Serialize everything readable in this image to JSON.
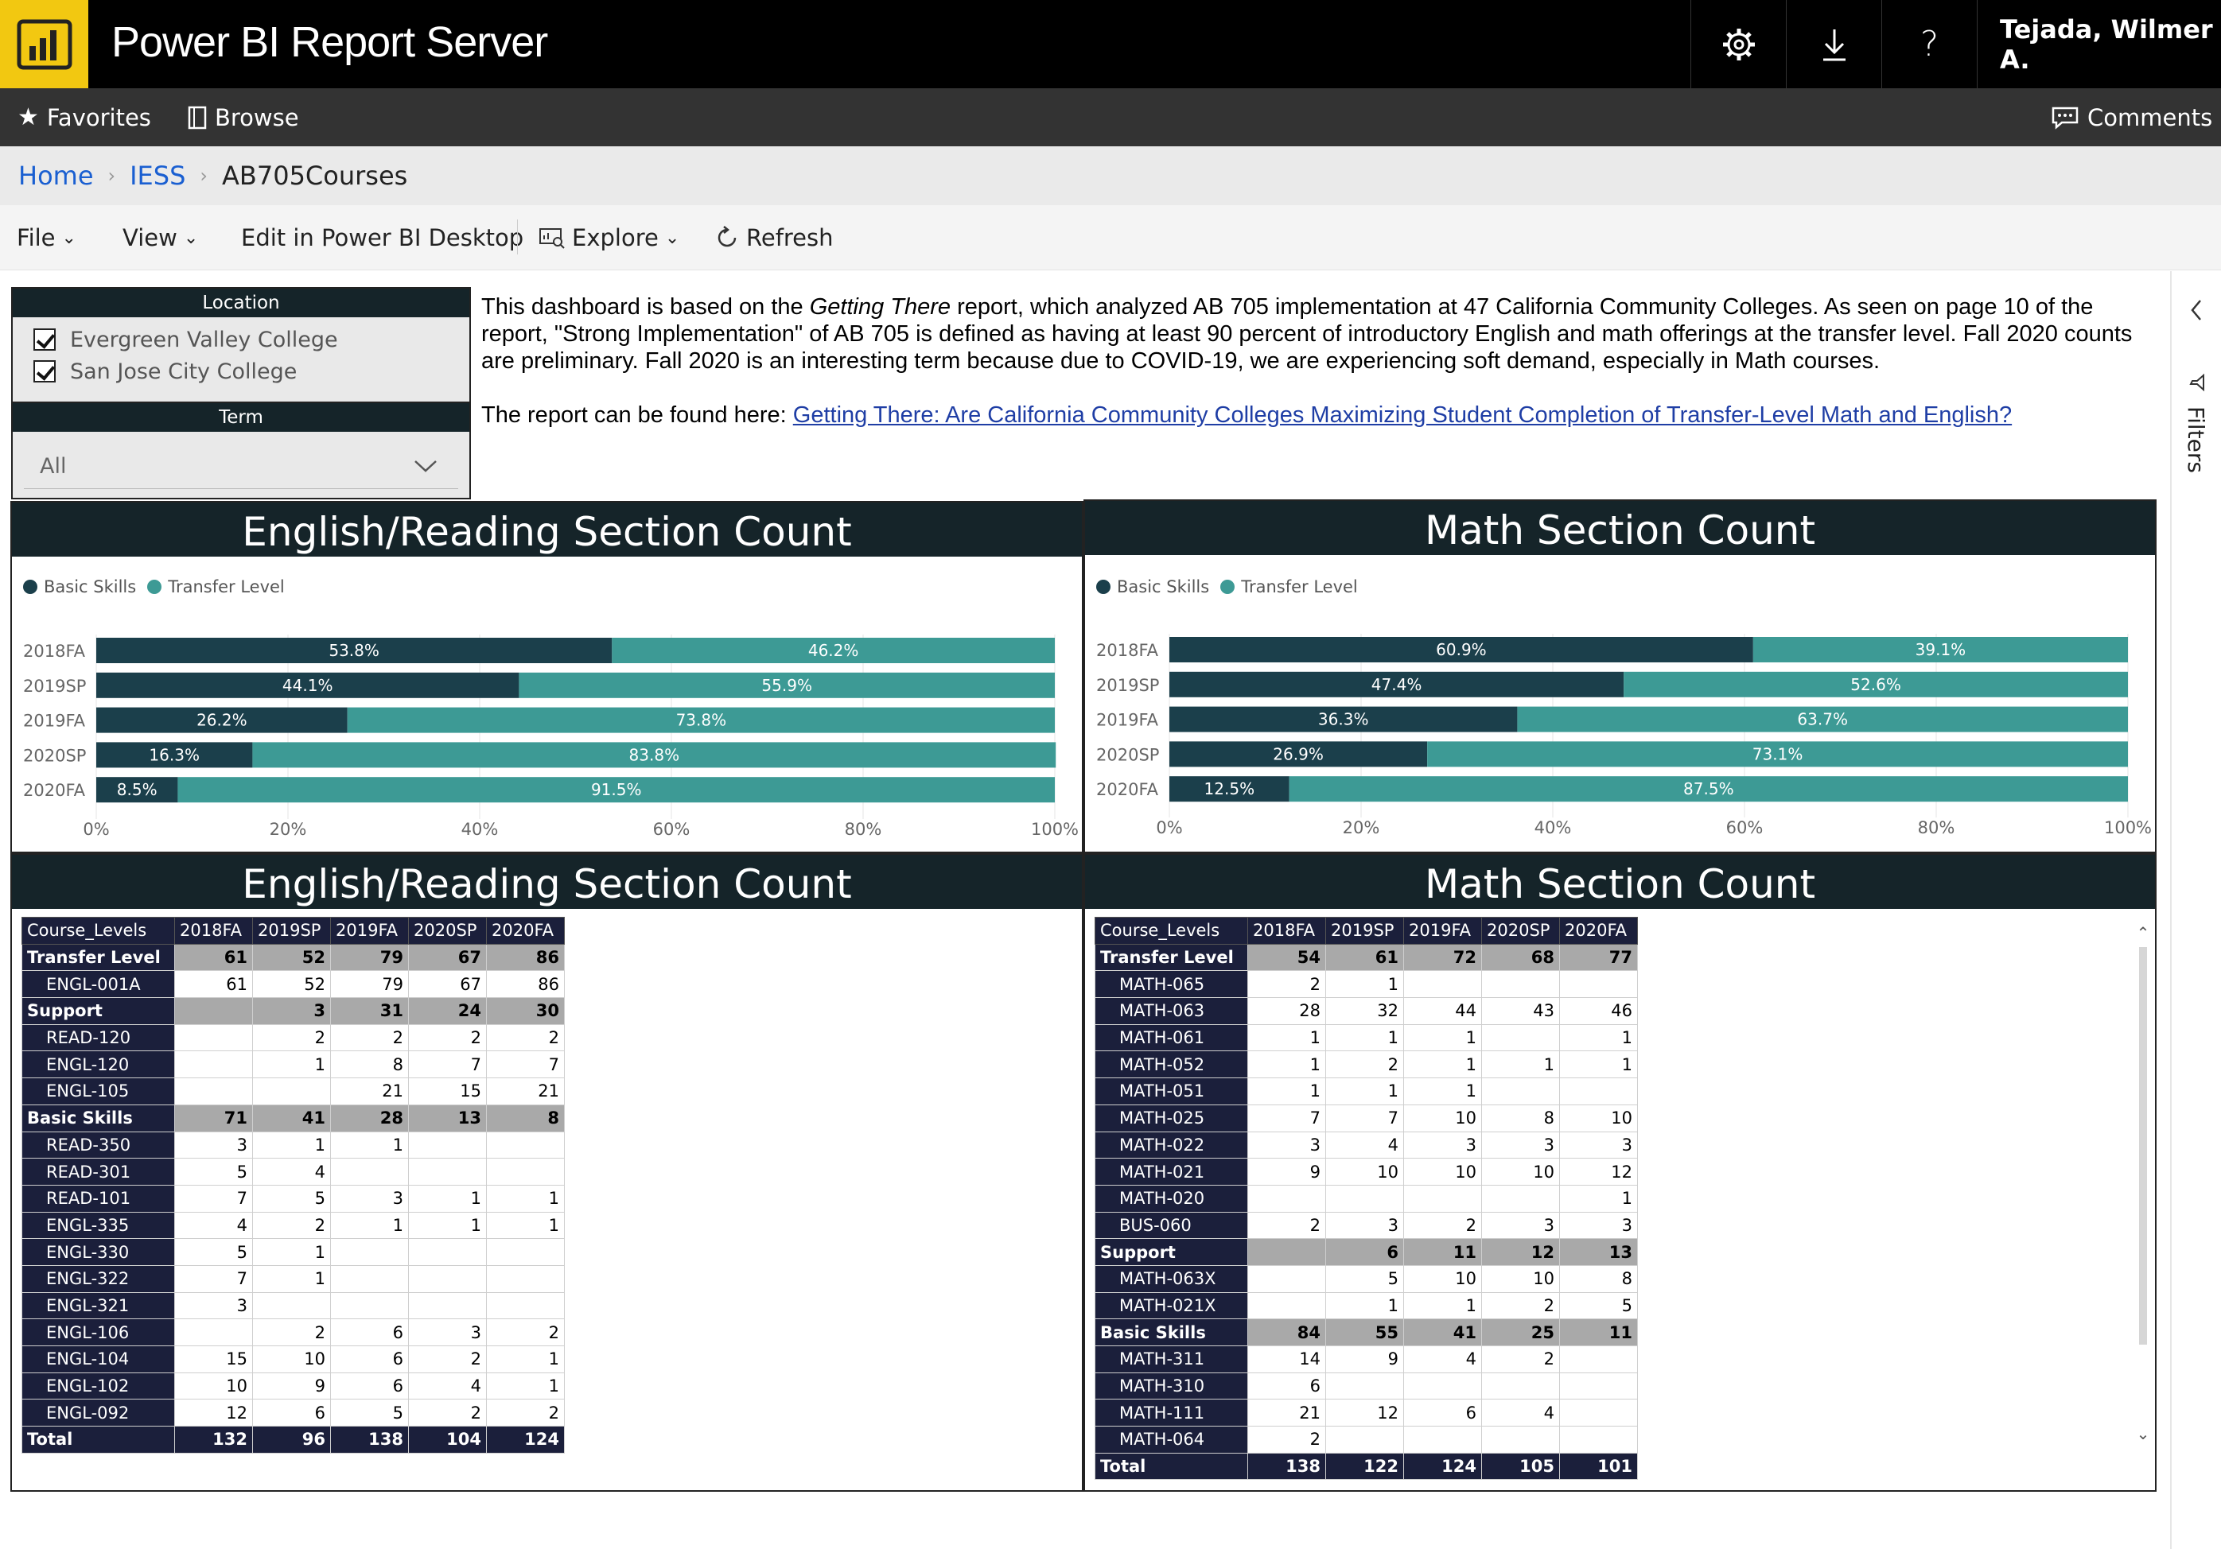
{
  "app": {
    "title": "Power BI Report Server",
    "user": "Tejada, Wilmer A."
  },
  "topbar": {
    "icons": [
      "gear-icon",
      "download-icon",
      "help-icon"
    ],
    "help_glyph": "?"
  },
  "nav": {
    "favorites": "Favorites",
    "browse": "Browse",
    "comments": "Comments"
  },
  "breadcrumb": {
    "home": "Home",
    "folder": "IESS",
    "current": "AB705Courses"
  },
  "toolbar": {
    "file": "File",
    "view": "View",
    "edit": "Edit in Power BI Desktop",
    "explore": "Explore",
    "refresh": "Refresh"
  },
  "slicers": {
    "location": {
      "title": "Location",
      "items": [
        "Evergreen Valley College",
        "San Jose City College"
      ]
    },
    "term": {
      "title": "Term",
      "value": "All"
    }
  },
  "description": {
    "p1_before": "This dashboard is based on the ",
    "p1_italic": "Getting There",
    "p1_after": " report, which analyzed AB 705 implementation at 47 California Community Colleges. As seen on page 10 of the report, \"Strong Implementation\" of AB 705 is defined as having at least 90 percent of introductory English and math offerings at the transfer level. Fall 2020 counts are preliminary. Fall 2020 is an interesting term because due to COVID-19, we are experiencing soft demand, especially in Math courses.",
    "p2_before": "The report can be found here: ",
    "p2_link": "Getting There: Are California Community Colleges Maximizing Student Completion of Transfer-Level Math and English?"
  },
  "filters_rail": {
    "label": "Filters"
  },
  "colors": {
    "basic": "#1b3f4b",
    "transfer": "#3d9a95",
    "header": "#152429",
    "matrix_header": "#1b1f3b",
    "accent": "#f2c811"
  },
  "chart_data": [
    {
      "type": "bar",
      "title": "English/Reading Section Count",
      "stacked": "100%",
      "categories": [
        "2018FA",
        "2019SP",
        "2019FA",
        "2020SP",
        "2020FA"
      ],
      "series": [
        {
          "name": "Basic Skills",
          "values": [
            53.8,
            44.1,
            26.2,
            16.3,
            8.5
          ]
        },
        {
          "name": "Transfer Level",
          "values": [
            46.2,
            55.9,
            73.8,
            83.8,
            91.5
          ]
        }
      ],
      "xticks": [
        "0%",
        "20%",
        "40%",
        "60%",
        "80%",
        "100%"
      ],
      "xlim": [
        0,
        100
      ],
      "legend": "top-left"
    },
    {
      "type": "bar",
      "title": "Math Section Count",
      "stacked": "100%",
      "categories": [
        "2018FA",
        "2019SP",
        "2019FA",
        "2020SP",
        "2020FA"
      ],
      "series": [
        {
          "name": "Basic Skills",
          "values": [
            60.9,
            47.4,
            36.3,
            26.9,
            12.5
          ]
        },
        {
          "name": "Transfer Level",
          "values": [
            39.1,
            52.6,
            63.7,
            73.1,
            87.5
          ]
        }
      ],
      "xticks": [
        "0%",
        "20%",
        "40%",
        "60%",
        "80%",
        "100%"
      ],
      "xlim": [
        0,
        100
      ],
      "legend": "top-left"
    },
    {
      "type": "table",
      "title": "English/Reading Section Count",
      "columns": [
        "Course_Levels",
        "2018FA",
        "2019SP",
        "2019FA",
        "2020SP",
        "2020FA"
      ],
      "rows": [
        {
          "label": "Transfer Level",
          "group": true,
          "values": [
            "61",
            "52",
            "79",
            "67",
            "86"
          ]
        },
        {
          "label": "ENGL-001A",
          "values": [
            "61",
            "52",
            "79",
            "67",
            "86"
          ]
        },
        {
          "label": "Support",
          "group": true,
          "values": [
            "",
            "3",
            "31",
            "24",
            "30"
          ]
        },
        {
          "label": "READ-120",
          "values": [
            "",
            "2",
            "2",
            "2",
            "2"
          ]
        },
        {
          "label": "ENGL-120",
          "values": [
            "",
            "1",
            "8",
            "7",
            "7"
          ]
        },
        {
          "label": "ENGL-105",
          "values": [
            "",
            "",
            "21",
            "15",
            "21"
          ]
        },
        {
          "label": "Basic Skills",
          "group": true,
          "values": [
            "71",
            "41",
            "28",
            "13",
            "8"
          ]
        },
        {
          "label": "READ-350",
          "values": [
            "3",
            "1",
            "1",
            "",
            ""
          ]
        },
        {
          "label": "READ-301",
          "values": [
            "5",
            "4",
            "",
            "",
            ""
          ]
        },
        {
          "label": "READ-101",
          "values": [
            "7",
            "5",
            "3",
            "1",
            "1"
          ]
        },
        {
          "label": "ENGL-335",
          "values": [
            "4",
            "2",
            "1",
            "1",
            "1"
          ]
        },
        {
          "label": "ENGL-330",
          "values": [
            "5",
            "1",
            "",
            "",
            ""
          ]
        },
        {
          "label": "ENGL-322",
          "values": [
            "7",
            "1",
            "",
            "",
            ""
          ]
        },
        {
          "label": "ENGL-321",
          "values": [
            "3",
            "",
            "",
            "",
            ""
          ]
        },
        {
          "label": "ENGL-106",
          "values": [
            "",
            "2",
            "6",
            "3",
            "2"
          ]
        },
        {
          "label": "ENGL-104",
          "values": [
            "15",
            "10",
            "6",
            "2",
            "1"
          ]
        },
        {
          "label": "ENGL-102",
          "values": [
            "10",
            "9",
            "6",
            "4",
            "1"
          ]
        },
        {
          "label": "ENGL-092",
          "values": [
            "12",
            "6",
            "5",
            "2",
            "2"
          ]
        },
        {
          "label": "Total",
          "total": true,
          "values": [
            "132",
            "96",
            "138",
            "104",
            "124"
          ]
        }
      ]
    },
    {
      "type": "table",
      "title": "Math Section Count",
      "columns": [
        "Course_Levels",
        "2018FA",
        "2019SP",
        "2019FA",
        "2020SP",
        "2020FA"
      ],
      "rows": [
        {
          "label": "Transfer Level",
          "group": true,
          "values": [
            "54",
            "61",
            "72",
            "68",
            "77"
          ]
        },
        {
          "label": "MATH-065",
          "values": [
            "2",
            "1",
            "",
            "",
            ""
          ]
        },
        {
          "label": "MATH-063",
          "values": [
            "28",
            "32",
            "44",
            "43",
            "46"
          ]
        },
        {
          "label": "MATH-061",
          "values": [
            "1",
            "1",
            "1",
            "",
            "1"
          ]
        },
        {
          "label": "MATH-052",
          "values": [
            "1",
            "2",
            "1",
            "1",
            "1"
          ]
        },
        {
          "label": "MATH-051",
          "values": [
            "1",
            "1",
            "1",
            "",
            ""
          ]
        },
        {
          "label": "MATH-025",
          "values": [
            "7",
            "7",
            "10",
            "8",
            "10"
          ]
        },
        {
          "label": "MATH-022",
          "values": [
            "3",
            "4",
            "3",
            "3",
            "3"
          ]
        },
        {
          "label": "MATH-021",
          "values": [
            "9",
            "10",
            "10",
            "10",
            "12"
          ]
        },
        {
          "label": "MATH-020",
          "values": [
            "",
            "",
            "",
            "",
            "1"
          ]
        },
        {
          "label": "BUS-060",
          "values": [
            "2",
            "3",
            "2",
            "3",
            "3"
          ]
        },
        {
          "label": "Support",
          "group": true,
          "values": [
            "",
            "6",
            "11",
            "12",
            "13"
          ]
        },
        {
          "label": "MATH-063X",
          "values": [
            "",
            "5",
            "10",
            "10",
            "8"
          ]
        },
        {
          "label": "MATH-021X",
          "values": [
            "",
            "1",
            "1",
            "2",
            "5"
          ]
        },
        {
          "label": "Basic Skills",
          "group": true,
          "values": [
            "84",
            "55",
            "41",
            "25",
            "11"
          ]
        },
        {
          "label": "MATH-311",
          "values": [
            "14",
            "9",
            "4",
            "2",
            ""
          ]
        },
        {
          "label": "MATH-310",
          "values": [
            "6",
            "",
            "",
            "",
            ""
          ]
        },
        {
          "label": "MATH-111",
          "values": [
            "21",
            "12",
            "6",
            "4",
            ""
          ]
        },
        {
          "label": "MATH-064",
          "values": [
            "2",
            "",
            "",
            "",
            ""
          ]
        },
        {
          "label": "Total",
          "total": true,
          "values": [
            "138",
            "122",
            "124",
            "105",
            "101"
          ]
        }
      ]
    }
  ]
}
